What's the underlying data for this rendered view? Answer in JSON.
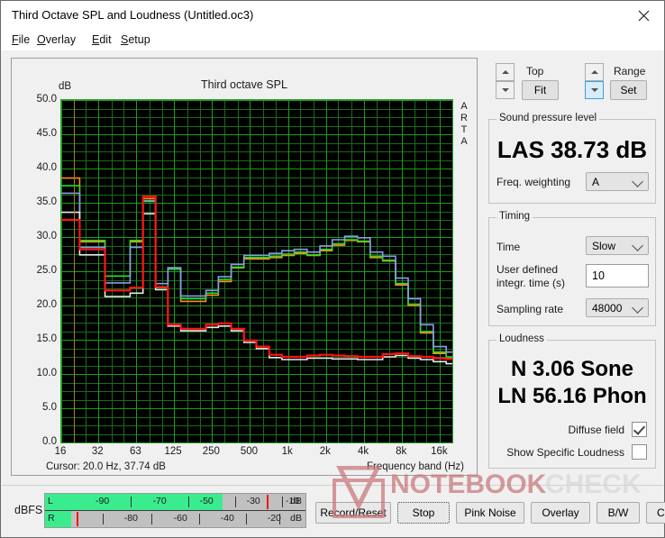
{
  "window": {
    "title": "Third Octave SPL and Loudness (Untitled.oc3)",
    "close_icon": "close-icon"
  },
  "menu": [
    {
      "label": "File",
      "accel": "F"
    },
    {
      "label": "Overlay",
      "accel": "O"
    },
    {
      "label": "Edit",
      "accel": "E"
    },
    {
      "label": "Setup",
      "accel": "S"
    }
  ],
  "graph": {
    "chart_title": "Third octave SPL",
    "unit_label": "dB",
    "watermark_side": "ARTA",
    "cursor_text": "Cursor:   20.0 Hz, 37.74 dB",
    "xaxis_caption": "Frequency band (Hz)"
  },
  "controls": {
    "top_label": "Top",
    "top_fit_button": "Fit",
    "range_label": "Range",
    "range_set_button": "Set",
    "spin_up_icon": "chevron-up-icon",
    "spin_down_icon": "chevron-down-icon"
  },
  "spl": {
    "group_title": "Sound pressure level",
    "value": "LAS 38.73 dB",
    "weighting_label": "Freq. weighting",
    "weighting_value": "A"
  },
  "timing": {
    "group_title": "Timing",
    "time_label": "Time",
    "time_value": "Slow",
    "integr_label_line1": "User defined",
    "integr_label_line2": "integr. time (s)",
    "integr_value": "10",
    "sampling_label": "Sampling rate",
    "sampling_value": "48000"
  },
  "loudness": {
    "group_title": "Loudness",
    "sone": "N 3.06 Sone",
    "phon": "LN 56.16 Phon",
    "diffuse_label": "Diffuse field",
    "diffuse_checked": true,
    "specific_label": "Show Specific Loudness",
    "specific_checked": false
  },
  "meter": {
    "label": "dBFS",
    "left_channel": "L",
    "right_channel": "R",
    "unit": "dB",
    "top_ticks": [
      "-90",
      "-70",
      "-50",
      "-30",
      "-10"
    ],
    "bottom_ticks": [
      "-80",
      "-60",
      "-40",
      "-20"
    ],
    "left_level_pct": 68,
    "right_level_pct": 10,
    "left_peak_pct": 85,
    "right_peak_pct": 12
  },
  "buttons": [
    {
      "label": "Record/Reset",
      "focused": false
    },
    {
      "label": "Stop",
      "focused": true
    },
    {
      "label": "Pink Noise",
      "focused": false
    },
    {
      "label": "Overlay",
      "focused": false
    },
    {
      "label": "B/W",
      "focused": false
    },
    {
      "label": "Copy",
      "focused": false
    }
  ],
  "colors": {
    "trace_orange": "#ff8a1e",
    "trace_green": "#22dd22",
    "trace_blue": "#8a9bf0",
    "trace_white": "#e8e8e8",
    "trace_red": "#ff1414",
    "grid_major": "#18a018",
    "grid_minor": "#1b6b1b",
    "plot_bg": "#000000",
    "cursor_line": "#9a8620",
    "meter_green": "#3bec8e",
    "meter_peak": "#f21111"
  },
  "chart_data": {
    "type": "line",
    "title": "Third octave SPL",
    "xlabel": "Frequency band (Hz)",
    "ylabel": "dB",
    "ylim": [
      0.0,
      50.0
    ],
    "ytick_values": [
      50.0,
      45.0,
      40.0,
      35.0,
      30.0,
      25.0,
      20.0,
      15.0,
      10.0,
      5.0,
      0.0
    ],
    "ytick_labels": [
      "50.0",
      "45.0",
      "40.0",
      "35.0",
      "30.0",
      "25.0",
      "20.0",
      "15.0",
      "10.0",
      "5.0",
      "0.0"
    ],
    "xtick_labels": [
      "16",
      "32",
      "63",
      "125",
      "250",
      "500",
      "1k",
      "2k",
      "4k",
      "8k",
      "16k"
    ],
    "grid": true,
    "legend": false,
    "step": true,
    "x_bands": [
      16,
      20,
      25,
      31.5,
      40,
      50,
      63,
      80,
      100,
      125,
      160,
      200,
      250,
      315,
      400,
      500,
      630,
      800,
      1000,
      1250,
      1600,
      2000,
      2500,
      3150,
      4000,
      5000,
      6300,
      8000,
      10000,
      12500,
      16000,
      20000
    ],
    "series": [
      {
        "name": "trace-orange",
        "color": "#ff8a1e",
        "values": [
          38.6,
          38.6,
          29.3,
          29.3,
          24.3,
          24.3,
          29.3,
          35.6,
          22.6,
          25.5,
          20.6,
          20.6,
          21.5,
          23.5,
          25.5,
          26.8,
          26.8,
          27.0,
          27.3,
          27.6,
          27.3,
          28.0,
          28.8,
          29.5,
          29.3,
          27.0,
          26.5,
          23.0,
          20.0,
          16.0,
          13.0,
          12.3
        ]
      },
      {
        "name": "trace-green",
        "color": "#22dd22",
        "values": [
          37.5,
          37.5,
          29.5,
          29.5,
          24.3,
          24.3,
          29.5,
          35.3,
          22.6,
          25.3,
          21.0,
          21.0,
          21.8,
          23.8,
          25.6,
          27.0,
          27.0,
          27.2,
          27.5,
          27.8,
          27.4,
          28.2,
          29.0,
          29.6,
          29.4,
          27.2,
          26.6,
          23.2,
          20.2,
          16.2,
          13.2,
          12.5
        ]
      },
      {
        "name": "trace-blue",
        "color": "#8a9bf0",
        "values": [
          36.4,
          36.4,
          28.5,
          28.5,
          23.3,
          23.3,
          28.5,
          35.2,
          23.2,
          25.5,
          21.4,
          21.4,
          22.2,
          24.2,
          26.0,
          27.3,
          27.3,
          27.6,
          28.0,
          28.2,
          27.8,
          28.7,
          29.6,
          30.1,
          29.9,
          27.8,
          27.2,
          24.0,
          21.0,
          17.2,
          14.0,
          13.2
        ]
      },
      {
        "name": "trace-white",
        "color": "#e8e8e8",
        "values": [
          33.6,
          33.6,
          27.4,
          27.4,
          21.3,
          21.3,
          21.8,
          33.4,
          22.3,
          17.0,
          16.3,
          16.3,
          16.8,
          17.0,
          16.3,
          14.6,
          13.7,
          12.4,
          12.1,
          12.1,
          12.3,
          12.3,
          12.2,
          12.2,
          12.1,
          12.1,
          12.5,
          12.7,
          12.3,
          12.1,
          11.8,
          11.5
        ]
      },
      {
        "name": "trace-red",
        "color": "#ff1414",
        "values": [
          32.5,
          32.5,
          28.2,
          28.2,
          22.2,
          22.2,
          22.6,
          35.9,
          22.7,
          17.2,
          16.6,
          16.6,
          17.2,
          17.4,
          16.6,
          14.9,
          14.0,
          12.8,
          12.5,
          12.5,
          12.7,
          12.8,
          12.7,
          12.6,
          12.5,
          12.5,
          12.9,
          13.0,
          12.6,
          12.5,
          12.3,
          12.2
        ]
      }
    ],
    "cursor": {
      "freq_hz": 20.0,
      "level_db": 37.74,
      "label": "Cursor:   20.0 Hz, 37.74 dB"
    }
  }
}
